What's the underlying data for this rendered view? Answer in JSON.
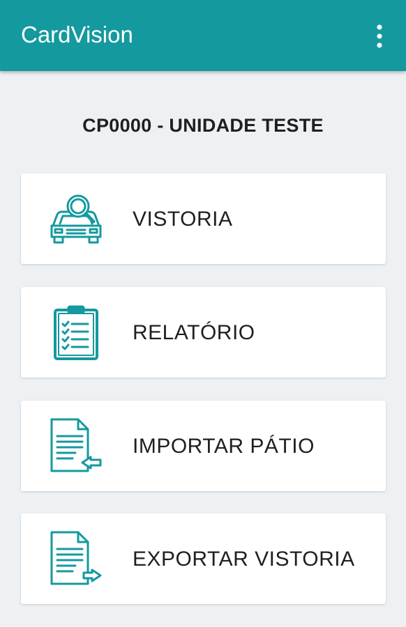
{
  "app": {
    "title": "CardVision",
    "accent_color": "#14999f",
    "overflow_icon": "more-vert-icon"
  },
  "unit": {
    "title": "CP0000 - UNIDADE TESTE"
  },
  "menu": {
    "items": [
      {
        "label": "VISTORIA",
        "icon": "car-inspection-icon"
      },
      {
        "label": "RELATÓRIO",
        "icon": "clipboard-checklist-icon"
      },
      {
        "label": "IMPORTAR PÁTIO",
        "icon": "document-import-icon"
      },
      {
        "label": "EXPORTAR VISTORIA",
        "icon": "document-export-icon"
      }
    ]
  }
}
